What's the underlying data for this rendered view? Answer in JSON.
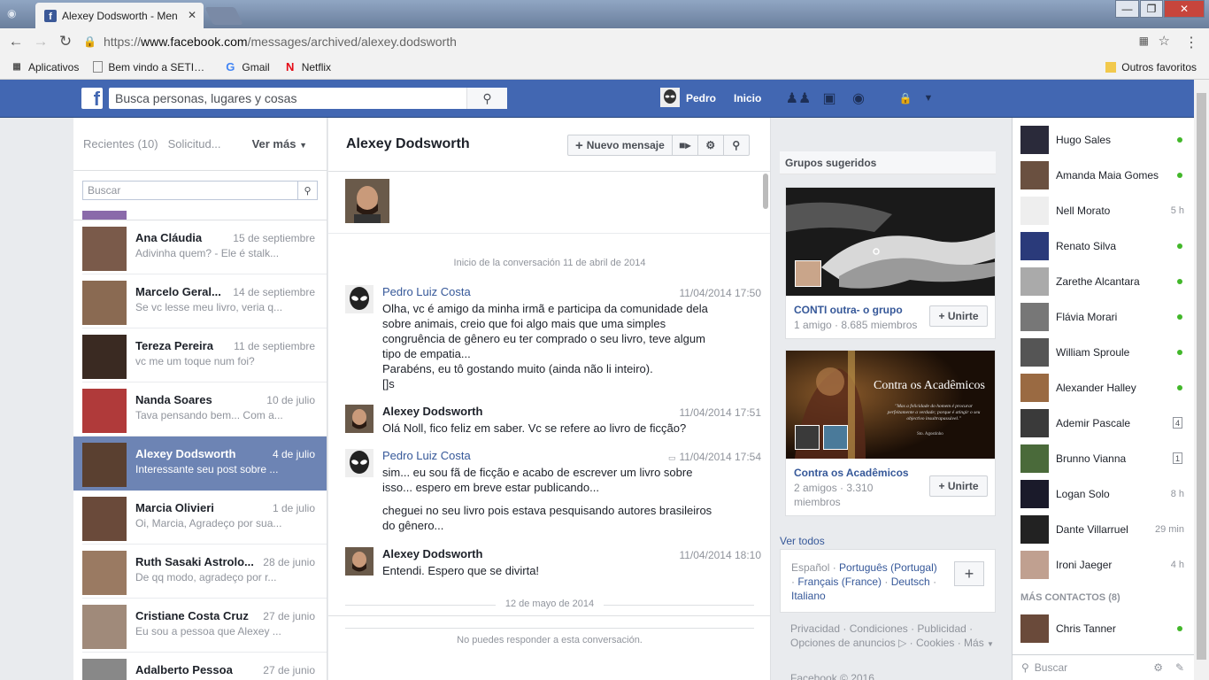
{
  "browser": {
    "tab_title": "Alexey Dodsworth - Men",
    "url_scheme": "https://",
    "url_host": "www.facebook.com",
    "url_path": "/messages/archived/alexey.dodsworth",
    "bookmarks": [
      {
        "label": "Aplicativos"
      },
      {
        "label": "Bem vindo a SETI@ho"
      },
      {
        "label": "Gmail"
      },
      {
        "label": "Netflix"
      }
    ],
    "other_bookmarks": "Outros favoritos"
  },
  "header": {
    "search_placeholder": "Busca personas, lugares y cosas",
    "user_name": "Pedro",
    "home_label": "Inicio"
  },
  "threads_panel": {
    "recent_tab": "Recientes",
    "recent_count": "(10)",
    "requests_tab": "Solicitud...",
    "more_label": "Ver más",
    "search_placeholder": "Buscar",
    "threads": [
      {
        "name": "Ana Cláudia",
        "date": "15 de septiembre",
        "snippet": "Adivinha quem? - Ele é stalk...",
        "color": "#7a5a4a"
      },
      {
        "name": "Marcelo Geral...",
        "date": "14 de septiembre",
        "snippet": "Se vc lesse meu livro, veria q...",
        "color": "#8a6a52"
      },
      {
        "name": "Tereza Pereira",
        "date": "11 de septiembre",
        "snippet": "vc me um toque num foi?",
        "color": "#3a2a22"
      },
      {
        "name": "Nanda Soares",
        "date": "10 de julio",
        "snippet": "Tava pensando bem... Com a...",
        "color": "#b03a3a"
      },
      {
        "name": "Alexey Dodsworth",
        "date": "4 de julio",
        "snippet": "Interessante seu post sobre ...",
        "color": "#5a4030",
        "active": true
      },
      {
        "name": "Marcia Olivieri",
        "date": "1 de julio",
        "snippet": "Oi, Marcia, Agradeço por sua...",
        "color": "#6a4a3a"
      },
      {
        "name": "Ruth Sasaki Astrolo...",
        "date": "28 de junio",
        "snippet": "De qq modo, agradeço por r...",
        "color": "#9a7a62"
      },
      {
        "name": "Cristiane Costa Cruz",
        "date": "27 de junio",
        "snippet": "Eu sou a pessoa que Alexey ...",
        "color": "#a08a7a"
      },
      {
        "name": "Adalberto Pessoa",
        "date": "27 de junio",
        "snippet": "",
        "color": "#888"
      }
    ]
  },
  "conversation": {
    "title": "Alexey Dodsworth",
    "new_message_label": "Nuevo mensaje",
    "start_label": "Inicio de la conversación 11 de abril de 2014",
    "messages": [
      {
        "author": "Pedro Luiz Costa",
        "time": "11/04/2014 17:50",
        "lines": [
          "Olha, vc é amigo da minha irmã e participa da comunidade dela sobre animais, creio que foi algo mais que uma simples congruência de gênero eu ter comprado o seu livro, teve algum tipo de empatia...",
          "Parabéns, eu tô gostando muito (ainda não li inteiro).",
          "[]s"
        ]
      },
      {
        "author": "Alexey Dodsworth",
        "time": "11/04/2014 17:51",
        "lines": [
          "Olá Noll, fico feliz em saber. Vc se refere ao livro de ficção?"
        ]
      },
      {
        "author": "Pedro Luiz Costa",
        "time": "11/04/2014 17:54",
        "lines": [
          "sim... eu sou fã de ficção e acabo de escrever um livro sobre isso... espero em breve estar publicando...",
          "cheguei no seu livro pois estava pesquisando autores brasileiros do gênero..."
        ]
      },
      {
        "author": "Alexey Dodsworth",
        "time": "11/04/2014 18:10",
        "lines": [
          "Entendi. Espero que se divirta!"
        ]
      }
    ],
    "date_separator": "12 de mayo de 2014",
    "no_reply": "No puedes responder a esta conversación."
  },
  "groups": {
    "title": "Grupos sugeridos",
    "cards": [
      {
        "name": "CONTI outra- o grupo",
        "meta": "1 amigo · 8.685 miembros",
        "join": "+ Unirte"
      },
      {
        "name": "Contra os Acadêmicos",
        "meta": "2 amigos · 3.310 miembros",
        "join": "+ Unirte",
        "banner": "Contra os Acadêmicos",
        "quote": "\"Mas a felicidade do homem é procurar perfeitamente a verdade; porque é atingir o seu objectivo insultrapassável.\"",
        "quote_author": "Sto. Agostinho"
      }
    ],
    "see_all": "Ver todos"
  },
  "languages": {
    "current": "Español",
    "options": [
      "Português (Portugal)",
      "Français (France)",
      "Deutsch",
      "Italiano"
    ]
  },
  "footer": {
    "links": [
      "Privacidad",
      "Condiciones",
      "Publicidad",
      "Opciones de anuncios",
      "Cookies",
      "Más"
    ],
    "copyright": "Facebook © 2016"
  },
  "chat": {
    "contacts": [
      {
        "name": "Hugo Sales",
        "status": "online",
        "color": "#2a2a3a"
      },
      {
        "name": "Amanda Maia Gomes",
        "status": "online",
        "color": "#6a5040"
      },
      {
        "name": "Nell Morato",
        "time": "5 h",
        "color": "#eee"
      },
      {
        "name": "Renato Silva",
        "status": "online",
        "color": "#2a3a7a"
      },
      {
        "name": "Zarethe Alcantara",
        "status": "online",
        "color": "#aaa"
      },
      {
        "name": "Flávia Morari",
        "status": "online",
        "color": "#777"
      },
      {
        "name": "William Sproule",
        "status": "online",
        "color": "#555"
      },
      {
        "name": "Alexander Halley",
        "status": "online",
        "color": "#9a6a42"
      },
      {
        "name": "Ademir Pascale",
        "badge": "4",
        "color": "#3a3a3a"
      },
      {
        "name": "Brunno Vianna",
        "badge": "1",
        "color": "#4a6a3a"
      },
      {
        "name": "Logan Solo",
        "time": "8 h",
        "color": "#1a1a2a"
      },
      {
        "name": "Dante Villarruel",
        "time": "29 min",
        "color": "#222"
      },
      {
        "name": "Ironi Jaeger",
        "time": "4 h",
        "color": "#c0a090"
      }
    ],
    "more_contacts": "MÁS CONTACTOS (8)",
    "more": [
      {
        "name": "Chris Tanner",
        "status": "online",
        "color": "#6a4a3a"
      }
    ],
    "search_placeholder": "Buscar"
  }
}
